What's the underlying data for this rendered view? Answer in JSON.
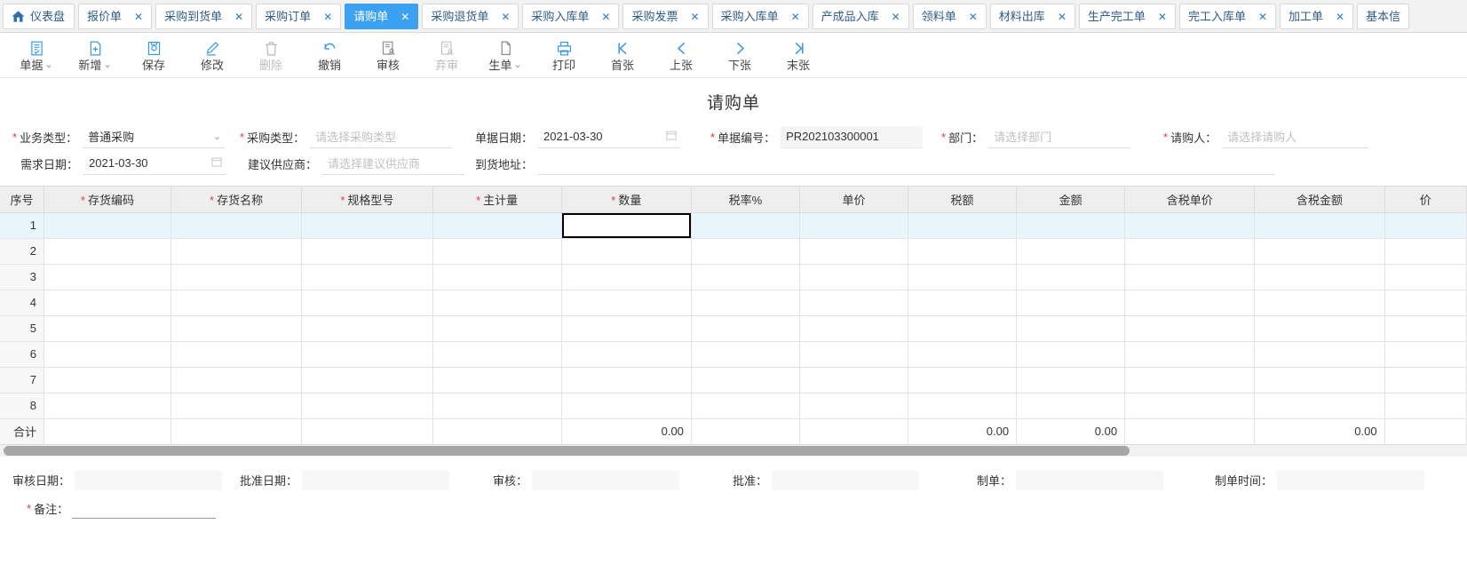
{
  "tabs": [
    {
      "label": "仪表盘",
      "icon": "home-icon",
      "closable": false,
      "active": false
    },
    {
      "label": "报价单",
      "closable": true,
      "active": false
    },
    {
      "label": "采购到货单",
      "closable": true,
      "active": false
    },
    {
      "label": "采购订单",
      "closable": true,
      "active": false
    },
    {
      "label": "请购单",
      "closable": true,
      "active": true
    },
    {
      "label": "采购退货单",
      "closable": true,
      "active": false
    },
    {
      "label": "采购入库单",
      "closable": true,
      "active": false
    },
    {
      "label": "采购发票",
      "closable": true,
      "active": false
    },
    {
      "label": "采购入库单",
      "closable": true,
      "active": false
    },
    {
      "label": "产成品入库",
      "closable": true,
      "active": false
    },
    {
      "label": "领料单",
      "closable": true,
      "active": false
    },
    {
      "label": "材料出库",
      "closable": true,
      "active": false
    },
    {
      "label": "生产完工单",
      "closable": true,
      "active": false
    },
    {
      "label": "完工入库单",
      "closable": true,
      "active": false
    },
    {
      "label": "加工单",
      "closable": true,
      "active": false
    },
    {
      "label": "基本信",
      "closable": false,
      "active": false
    }
  ],
  "tab_close_glyph": "✕",
  "toolbar": [
    {
      "label": "单据",
      "icon": "document-list-icon",
      "caret": true,
      "disabled": false
    },
    {
      "label": "新增",
      "icon": "file-add-icon",
      "caret": true,
      "disabled": false
    },
    {
      "label": "保存",
      "icon": "save-disk-icon",
      "caret": false,
      "disabled": false
    },
    {
      "label": "修改",
      "icon": "pencil-edit-icon",
      "caret": false,
      "disabled": false
    },
    {
      "label": "删除",
      "icon": "trash-icon",
      "caret": false,
      "disabled": true
    },
    {
      "label": "撤销",
      "icon": "undo-arrow-icon",
      "caret": false,
      "disabled": false
    },
    {
      "label": "审核",
      "icon": "audit-person-icon",
      "caret": false,
      "disabled": false
    },
    {
      "label": "弃审",
      "icon": "unaudit-person-icon",
      "caret": false,
      "disabled": true
    },
    {
      "label": "生单",
      "icon": "copy-pages-icon",
      "caret": true,
      "disabled": false
    },
    {
      "label": "打印",
      "icon": "printer-icon",
      "caret": false,
      "disabled": false
    },
    {
      "label": "首张",
      "icon": "first-page-icon",
      "caret": false,
      "disabled": false
    },
    {
      "label": "上张",
      "icon": "prev-page-icon",
      "caret": false,
      "disabled": false
    },
    {
      "label": "下张",
      "icon": "next-page-icon",
      "caret": false,
      "disabled": false
    },
    {
      "label": "末张",
      "icon": "last-page-icon",
      "caret": false,
      "disabled": false
    }
  ],
  "caret_glyph": "⌄",
  "title": "请购单",
  "header_fields": {
    "business_type": {
      "label": "业务类型",
      "value": "普通采购",
      "required": true
    },
    "purchase_type": {
      "label": "采购类型",
      "placeholder": "请选择采购类型",
      "required": true
    },
    "doc_date": {
      "label": "单据日期",
      "value": "2021-03-30",
      "required": false
    },
    "doc_no": {
      "label": "单据编号",
      "value": "PR202103300001",
      "required": true
    },
    "department": {
      "label": "部门",
      "placeholder": "请选择部门",
      "required": true
    },
    "requester": {
      "label": "请购人",
      "placeholder": "请选择请购人",
      "required": true
    },
    "demand_date": {
      "label": "需求日期",
      "value": "2021-03-30",
      "required": false
    },
    "suggest_supplier": {
      "label": "建议供应商",
      "placeholder": "请选择建议供应商",
      "required": false
    },
    "delivery_address": {
      "label": "到货地址",
      "value": "",
      "required": false
    }
  },
  "grid": {
    "columns": [
      {
        "label": "序号",
        "required": false
      },
      {
        "label": "存货编码",
        "required": true
      },
      {
        "label": "存货名称",
        "required": true
      },
      {
        "label": "规格型号",
        "required": true
      },
      {
        "label": "主计量",
        "required": true
      },
      {
        "label": "数量",
        "required": true
      },
      {
        "label": "税率%",
        "required": false
      },
      {
        "label": "单价",
        "required": false
      },
      {
        "label": "税额",
        "required": false
      },
      {
        "label": "金额",
        "required": false
      },
      {
        "label": "含税单价",
        "required": false
      },
      {
        "label": "含税金额",
        "required": false
      },
      {
        "label": "价",
        "required": false
      }
    ],
    "rows": [
      {
        "idx": "1",
        "cells": [
          "",
          "",
          "",
          "",
          "",
          "",
          "",
          "",
          "",
          "",
          "",
          ""
        ]
      },
      {
        "idx": "2",
        "cells": [
          "",
          "",
          "",
          "",
          "",
          "",
          "",
          "",
          "",
          "",
          "",
          ""
        ]
      },
      {
        "idx": "3",
        "cells": [
          "",
          "",
          "",
          "",
          "",
          "",
          "",
          "",
          "",
          "",
          "",
          ""
        ]
      },
      {
        "idx": "4",
        "cells": [
          "",
          "",
          "",
          "",
          "",
          "",
          "",
          "",
          "",
          "",
          "",
          ""
        ]
      },
      {
        "idx": "5",
        "cells": [
          "",
          "",
          "",
          "",
          "",
          "",
          "",
          "",
          "",
          "",
          "",
          ""
        ]
      },
      {
        "idx": "6",
        "cells": [
          "",
          "",
          "",
          "",
          "",
          "",
          "",
          "",
          "",
          "",
          "",
          ""
        ]
      },
      {
        "idx": "7",
        "cells": [
          "",
          "",
          "",
          "",
          "",
          "",
          "",
          "",
          "",
          "",
          "",
          ""
        ]
      },
      {
        "idx": "8",
        "cells": [
          "",
          "",
          "",
          "",
          "",
          "",
          "",
          "",
          "",
          "",
          "",
          ""
        ]
      }
    ],
    "selected_row": 1,
    "selected_column": 5,
    "totals": {
      "label": "合计",
      "cells": [
        "",
        "",
        "",
        "",
        "0.00",
        "",
        "",
        "0.00",
        "0.00",
        "",
        "0.00",
        ""
      ]
    }
  },
  "footer_fields": {
    "audit_date": {
      "label": "审核日期",
      "value": ""
    },
    "approve_date": {
      "label": "批准日期",
      "value": ""
    },
    "auditor": {
      "label": "审核",
      "value": ""
    },
    "approver": {
      "label": "批准",
      "value": ""
    },
    "maker": {
      "label": "制单",
      "value": ""
    },
    "make_time": {
      "label": "制单时间",
      "value": ""
    },
    "remark": {
      "label": "备注",
      "value": "",
      "required": true
    }
  },
  "colors": {
    "accent": "#3ba1f0",
    "tab_text": "#2f5c86",
    "required_star": "#e53935",
    "selected_row_bg": "#e8f5fd",
    "header_bg": "#eeeeee",
    "scrollbar_thumb": "#a6a6a6"
  }
}
